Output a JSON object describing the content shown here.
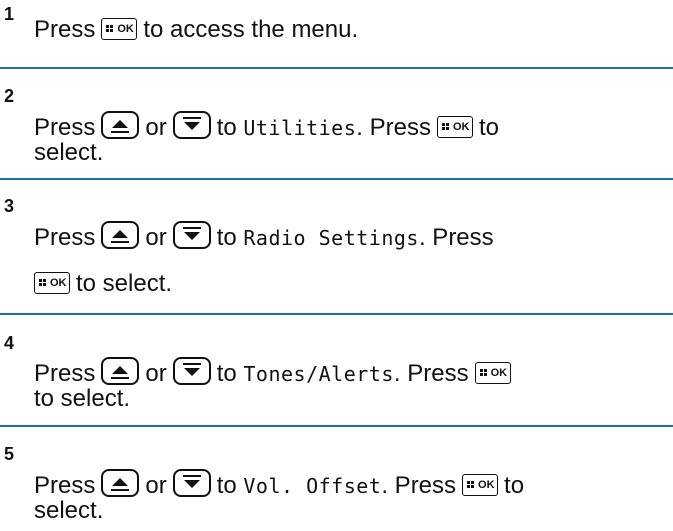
{
  "steps": [
    {
      "num": "1",
      "a": "Press",
      "b": "to access the menu."
    },
    {
      "num": "2",
      "a": "Press",
      "or": "or",
      "to": "to",
      "item": "Utilities",
      "c": ". Press",
      "d": "to",
      "e": "select."
    },
    {
      "num": "3",
      "a": "Press",
      "or": "or",
      "to": "to",
      "item": "Radio Settings",
      "c": ". Press",
      "e": "to select."
    },
    {
      "num": "4",
      "a": "Press",
      "or": "or",
      "to": "to",
      "item": "Tones/Alerts",
      "c": ". Press",
      "e": "to select."
    },
    {
      "num": "5",
      "a": "Press",
      "or": "or",
      "to": "to",
      "item": "Vol. Offset",
      "c": ". Press",
      "d": "to",
      "e": "select."
    }
  ],
  "buttons": {
    "ok_label": "OK"
  },
  "icons": {
    "menu_ok": "menu-ok-button-icon",
    "up": "up-arrow-button-icon",
    "down": "down-arrow-button-icon"
  },
  "colors": {
    "rule": "#1f6faa"
  }
}
